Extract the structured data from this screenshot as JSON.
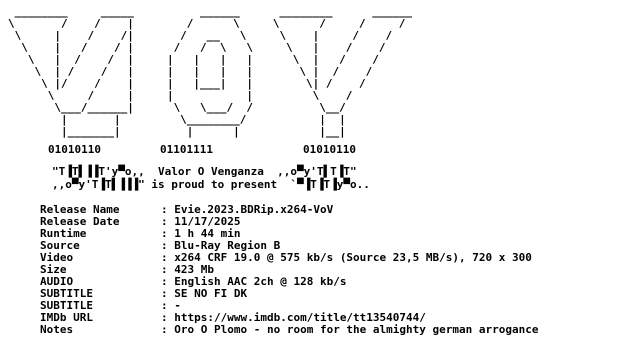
{
  "logo": {
    "art": " ________     _____          ______      ________      ______\n\\       /    /    |        /      \\     \\      /     /     /\n \\     |    /    /|       /   __   \\     \\    |     /    /\n  \\    |   /    / |      /   /  \\   \\     \\   |    /    /\n   \\   |  /    /  |     |   |   |   |      \\  |   /    /\n    \\  | /    /   |     |   |   |   |       \\ |  /    /\n     \\ |/    /    |     |   |___|   |        \\| /    /\n      \\     /     |     |           |         \\    /\n       \\___/______|      \\   \\___/  /          \\__/\n        |       |         \\________/           |  |\n        |_______|          |      |            |__|"
  },
  "binary": {
    "left": "01010110",
    "center": "01101111",
    "right": "01010110"
  },
  "tagline": {
    "line1": "\"T▐T▌▐▐T'у▀ο,,  Valor O Venganza  ,,o▀у'T▌T▐T\"",
    "line2": ",,o▀у'T▐T▌▐▐▐\" is proud to present  `▀▐T▐T▐у▀o.."
  },
  "info": {
    "rows": [
      {
        "key": "Release Name",
        "value": "Evie.2023.BDRip.x264-VoV"
      },
      {
        "key": "Release Date",
        "value": "11/17/2025"
      },
      {
        "key": "Runtime",
        "value": "1 h 44 min"
      },
      {
        "key": "Source",
        "value": "Blu-Ray Region B"
      },
      {
        "key": "Video",
        "value": "x264 CRF 19.0 @ 575 kb/s (Source 23,5 MB/s), 720 x 300"
      },
      {
        "key": "Size",
        "value": "423 Mb"
      },
      {
        "key": "AUDIO",
        "value": "English AAC 2ch @ 128 kb/s"
      },
      {
        "key": "SUBTITLE",
        "value": "SE NO FI DK"
      },
      {
        "key": "SUBTITLE",
        "value": "-"
      },
      {
        "key": "IMDb URL",
        "value": "https://www.imdb.com/title/tt13540744/"
      },
      {
        "key": "Notes",
        "value": "Oro O Plomo - no room for the almighty german arrogance"
      }
    ]
  }
}
